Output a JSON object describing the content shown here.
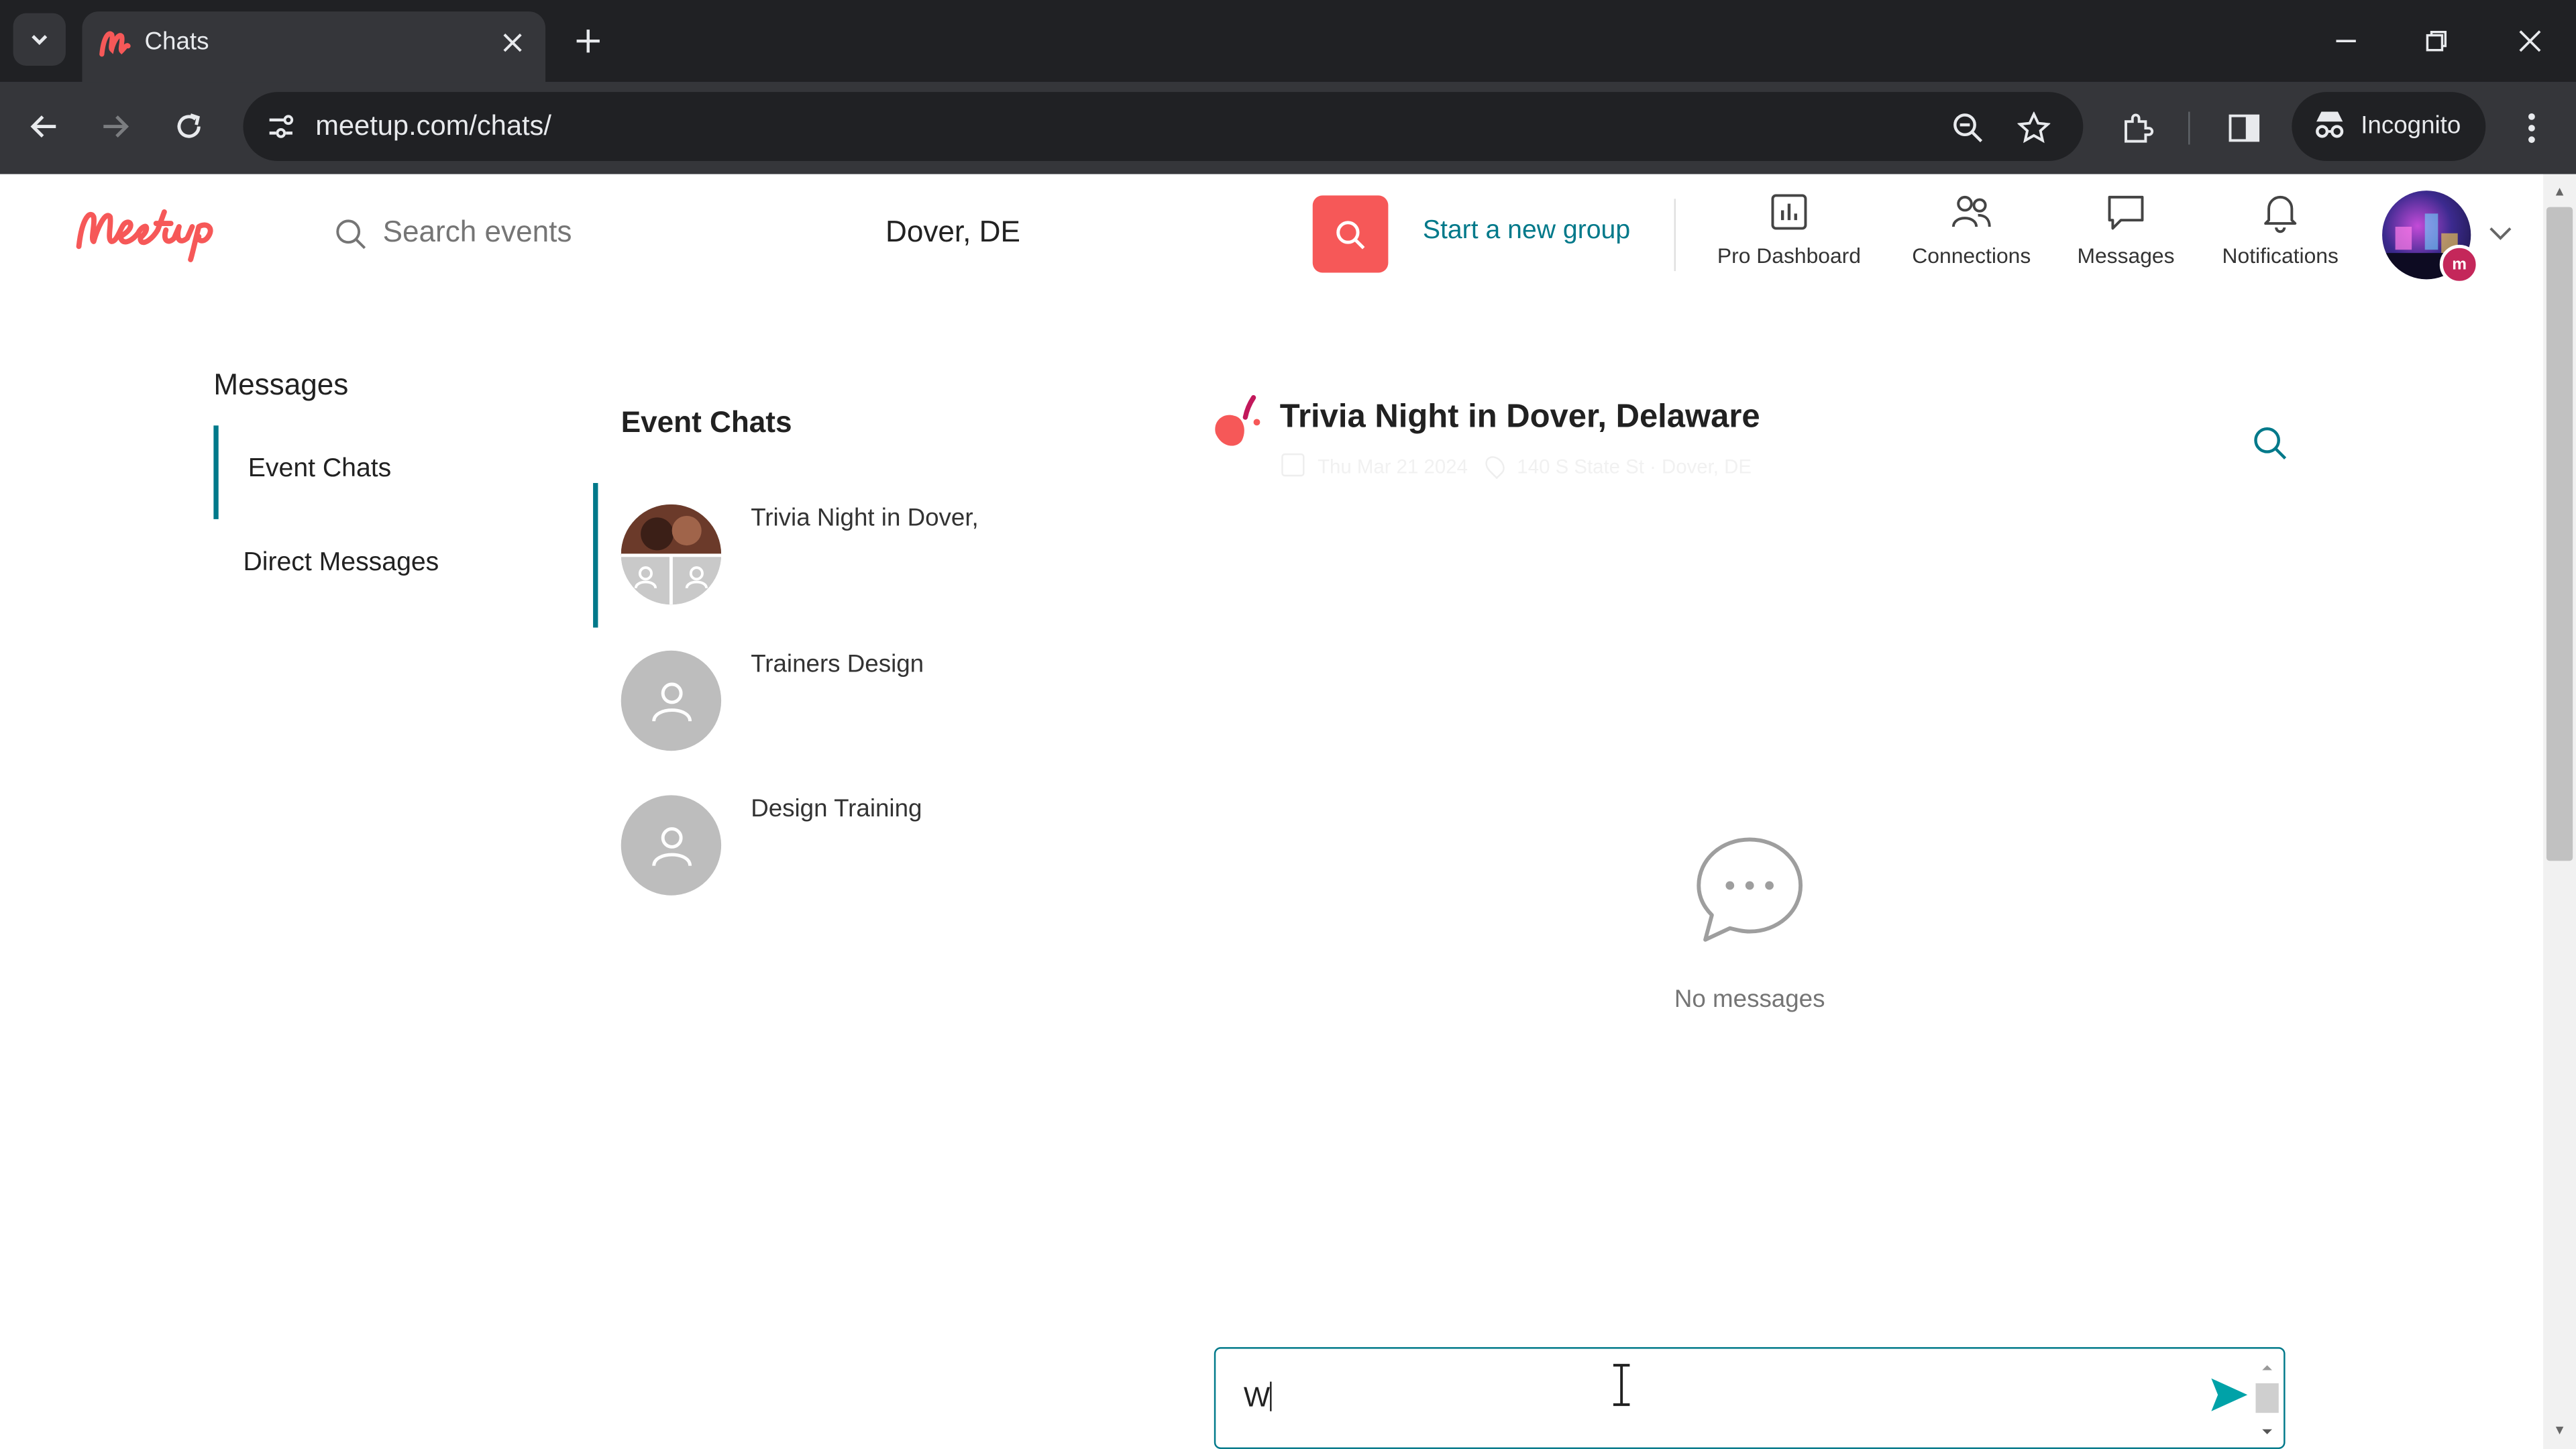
{
  "browser": {
    "tab_title": "Chats",
    "url": "meetup.com/chats/",
    "incognito_label": "Incognito",
    "icons": [
      "tab-list-icon",
      "close-icon",
      "plus-icon",
      "minimize-icon",
      "restore-icon",
      "back-icon",
      "forward-icon",
      "reload-icon",
      "site-info-icon",
      "zoom-icon",
      "star-icon",
      "extensions-icon",
      "sidebar-icon",
      "incognito-icon",
      "more-icon"
    ]
  },
  "header": {
    "logo_text": "Meetup",
    "search_placeholder": "Search events",
    "location": "Dover, DE",
    "start_group": "Start a new group",
    "nav": [
      {
        "label": "Pro Dashboard",
        "icon": "chart-icon"
      },
      {
        "label": "Connections",
        "icon": "people-icon"
      },
      {
        "label": "Messages",
        "icon": "chat-icon"
      },
      {
        "label": "Notifications",
        "icon": "bell-icon"
      }
    ],
    "avatar_badge": "m"
  },
  "sidebar": {
    "heading": "Messages",
    "items": [
      {
        "label": "Event Chats",
        "active": true
      },
      {
        "label": "Direct Messages",
        "active": false
      }
    ]
  },
  "chats": {
    "heading": "Event Chats",
    "items": [
      {
        "name": "Trivia Night in Dover,",
        "active": true
      },
      {
        "name": "Trainers Design",
        "active": false
      },
      {
        "name": "Design Training",
        "active": false
      }
    ]
  },
  "conversation": {
    "title": "Trivia Night in Dover, Delaware",
    "date": "Thu Mar 21 2024",
    "address": "140 S State St · Dover, DE",
    "empty_text": "No messages",
    "composer_value": "W"
  },
  "colors": {
    "brand": "#f65858",
    "accent": "#00798a",
    "send": "#00a2a8"
  }
}
